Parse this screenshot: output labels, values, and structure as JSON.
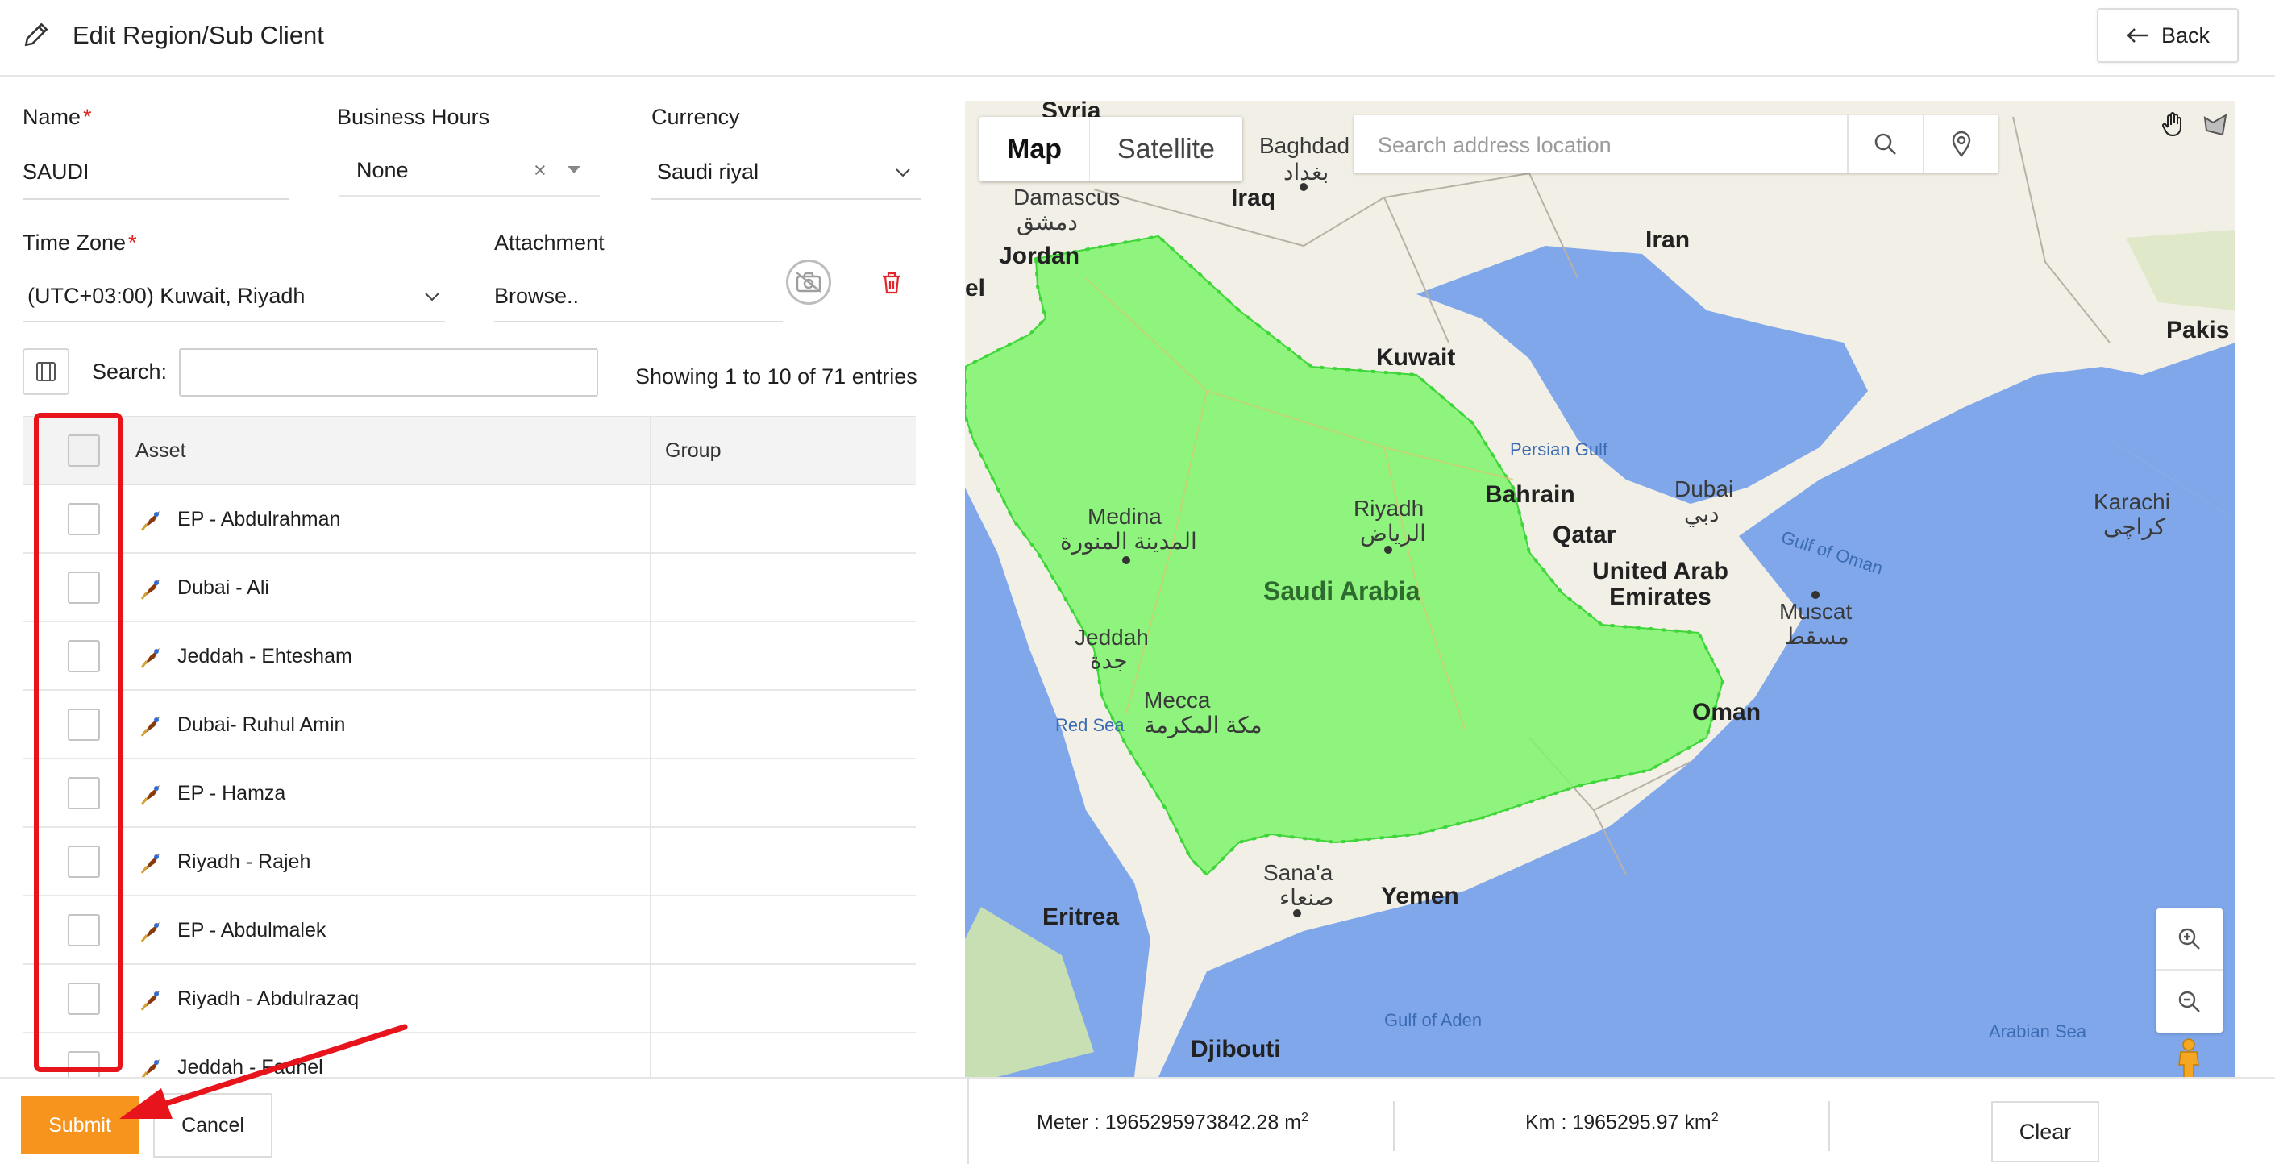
{
  "header": {
    "title": "Edit Region/Sub Client",
    "back_label": "Back"
  },
  "form": {
    "name_label": "Name",
    "name_value": "SAUDI",
    "business_hours_label": "Business Hours",
    "business_hours_value": "None",
    "business_hours_clear": "×",
    "currency_label": "Currency",
    "currency_value": "Saudi riyal",
    "timezone_label": "Time Zone",
    "timezone_value": "(UTC+03:00) Kuwait, Riyadh",
    "attachment_label": "Attachment",
    "attachment_value": "Browse..",
    "required_mark": "*"
  },
  "table": {
    "search_label": "Search:",
    "search_value": "",
    "showing_text": "Showing 1 to 10 of 71 entries",
    "columns": [
      "Asset",
      "Group"
    ],
    "rows": [
      {
        "asset": "EP - Abdulrahman",
        "group": ""
      },
      {
        "asset": "Dubai - Ali",
        "group": ""
      },
      {
        "asset": "Jeddah - Ehtesham",
        "group": ""
      },
      {
        "asset": "Dubai- Ruhul Amin",
        "group": ""
      },
      {
        "asset": "EP - Hamza",
        "group": ""
      },
      {
        "asset": "Riyadh - Rajeh",
        "group": ""
      },
      {
        "asset": "EP - Abdulmalek",
        "group": ""
      },
      {
        "asset": "Riyadh - Abdulrazaq",
        "group": ""
      },
      {
        "asset": "Jeddah - Fadhel",
        "group": ""
      }
    ]
  },
  "actions": {
    "submit_label": "Submit",
    "cancel_label": "Cancel",
    "clear_label": "Clear"
  },
  "area": {
    "meter_label": "Meter : 1965295973842.28 m",
    "km_label": "Km : 1965295.97 km",
    "superscript": "2"
  },
  "map": {
    "tab_map": "Map",
    "tab_satellite": "Satellite",
    "search_placeholder": "Search address location",
    "labels": {
      "syria": "Syria",
      "baghdad": "Baghdad",
      "baghdad_ar": "بغداد",
      "damascus": "Damascus",
      "damascus_ar": "دمشق",
      "iraq": "Iraq",
      "iran": "Iran",
      "jordan": "Jordan",
      "kuwait": "Kuwait",
      "pakistan": "Pakis",
      "persian_gulf": "Persian Gulf",
      "bahrain": "Bahrain",
      "dubai": "Dubai",
      "dubai_ar": "دبي",
      "karachi": "Karachi",
      "karachi_ar": "کراچی",
      "medina": "Medina",
      "medina_ar": "المدينة المنورة",
      "riyadh": "Riyadh",
      "riyadh_ar": "الرياض",
      "qatar": "Qatar",
      "uae": "United Arab\nEmirates",
      "gulf_of_oman": "Gulf of Oman",
      "saudi_arabia": "Saudi Arabia",
      "muscat": "Muscat",
      "muscat_ar": "مسقط",
      "jeddah": "Jeddah",
      "jeddah_ar": "جدة",
      "mecca": "Mecca",
      "mecca_ar": "مكة المكرمة",
      "red_sea": "Red Sea",
      "oman": "Oman",
      "sanaa": "Sana'a",
      "sanaa_ar": "صنعاء",
      "yemen": "Yemen",
      "eritrea": "Eritrea",
      "gulf_of_aden": "Gulf of Aden",
      "arabian_sea": "Arabian Sea",
      "djibouti": "Djibouti",
      "el": "el"
    }
  },
  "colors": {
    "submit_bg": "#f7941d",
    "required": "#e02020",
    "highlight": "#e8141c",
    "polygon_fill": "#7ef46b",
    "polygon_stroke": "#3fd63a",
    "water": "#7fa7ea",
    "land": "#f2efe6"
  }
}
